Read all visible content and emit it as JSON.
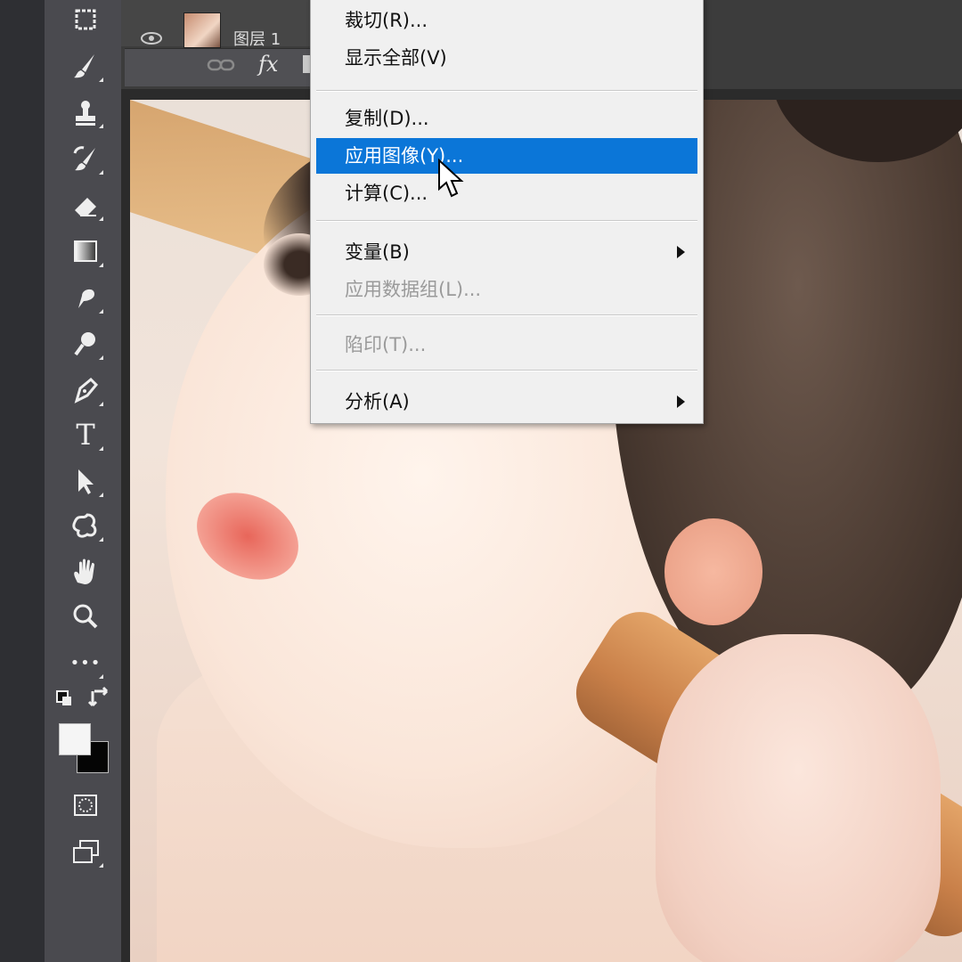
{
  "layers": {
    "layer_name": "图层 1",
    "fx_label": "fx"
  },
  "toolbar": {
    "tools": [
      "marquee-icon",
      "brush-icon",
      "stamp-icon",
      "history-brush-icon",
      "eraser-icon",
      "gradient-icon",
      "smudge-icon",
      "dodge-icon",
      "pen-icon",
      "type-icon",
      "path-select-icon",
      "custom-shape-icon",
      "hand-icon",
      "zoom-icon",
      "more-icon"
    ],
    "type_tool_glyph": "T",
    "more_glyph": "•••",
    "foreground_color": "#f5f5f5",
    "background_color": "#050505"
  },
  "context_menu": {
    "items": [
      {
        "label": "裁切(R)...",
        "disabled": false
      },
      {
        "label": "显示全部(V)",
        "disabled": false
      },
      {
        "label": "复制(D)...",
        "disabled": false
      },
      {
        "label": "应用图像(Y)...",
        "disabled": false,
        "highlighted": true
      },
      {
        "label": "计算(C)...",
        "disabled": false
      },
      {
        "label": "变量(B)",
        "disabled": false,
        "submenu": true
      },
      {
        "label": "应用数据组(L)...",
        "disabled": true
      },
      {
        "label": "陷印(T)...",
        "disabled": true
      },
      {
        "label": "分析(A)",
        "disabled": false,
        "submenu": true
      }
    ],
    "highlight_color": "#0b76d8"
  }
}
